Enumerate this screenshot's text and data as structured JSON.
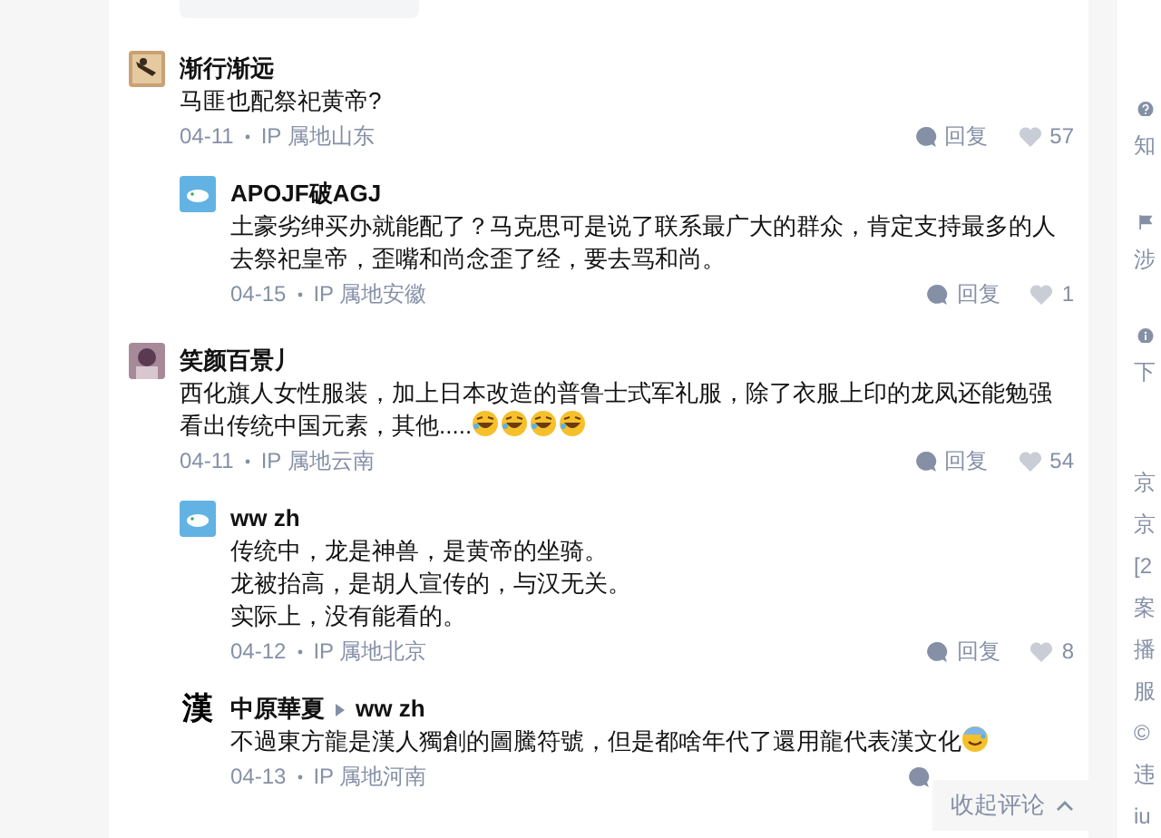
{
  "comments": [
    {
      "avatar": {
        "kind": "brown"
      },
      "name": "渐行渐远",
      "text": [
        "马匪也配祭祀黄帝?"
      ],
      "date": "04-11",
      "location": "IP 属地山东",
      "reply_label": "回复",
      "likes": "57",
      "replies": [
        {
          "avatar": {
            "kind": "blue"
          },
          "name": "APOJF破AGJ",
          "text": [
            "土豪劣绅买办就能配了？马克思可是说了联系最广大的群众，肯定支持最多的人去祭祀皇帝，歪嘴和尚念歪了经，要去骂和尚。"
          ],
          "date": "04-15",
          "location": "IP 属地安徽",
          "reply_label": "回复",
          "likes": "1"
        }
      ]
    },
    {
      "avatar": {
        "kind": "purple"
      },
      "name": "笑颜百景丿",
      "text": [
        "西化旗人女性服装，加上日本改造的普鲁士式军礼服，除了衣服上印的龙凤还能勉强看出传统中国元素，其他....."
      ],
      "emojis": [
        {
          "kind": "laugh"
        },
        {
          "kind": "laugh"
        },
        {
          "kind": "laugh"
        },
        {
          "kind": "laugh"
        }
      ],
      "date": "04-11",
      "location": "IP 属地云南",
      "reply_label": "回复",
      "likes": "54",
      "replies": [
        {
          "avatar": {
            "kind": "blue"
          },
          "name": "ww zh",
          "text": [
            "传统中，龙是神兽，是黄帝的坐骑。",
            "龙被抬高，是胡人宣传的，与汉无关。",
            "实际上，没有能看的。"
          ],
          "date": "04-12",
          "location": "IP 属地北京",
          "reply_label": "回复",
          "likes": "8"
        },
        {
          "avatar": {
            "kind": "glyph",
            "text": "漢"
          },
          "name": "中原華夏",
          "reply_to": "ww zh",
          "text": [
            "不過東方龍是漢人獨創的圖騰符號，但是都啥年代了還用龍代表漢文化"
          ],
          "emojis": [
            {
              "kind": "sweat"
            }
          ],
          "date": "04-13",
          "location": "IP 属地河南"
        }
      ]
    }
  ],
  "collapse_button": {
    "label": "收起评论"
  },
  "sidebar": {
    "items": [
      {
        "text": "知"
      },
      {
        "text": "涉"
      },
      {
        "text": "下"
      }
    ],
    "footer": [
      "京",
      "京",
      "[2",
      "案",
      "播",
      "服",
      "©",
      "违",
      "iu"
    ]
  }
}
